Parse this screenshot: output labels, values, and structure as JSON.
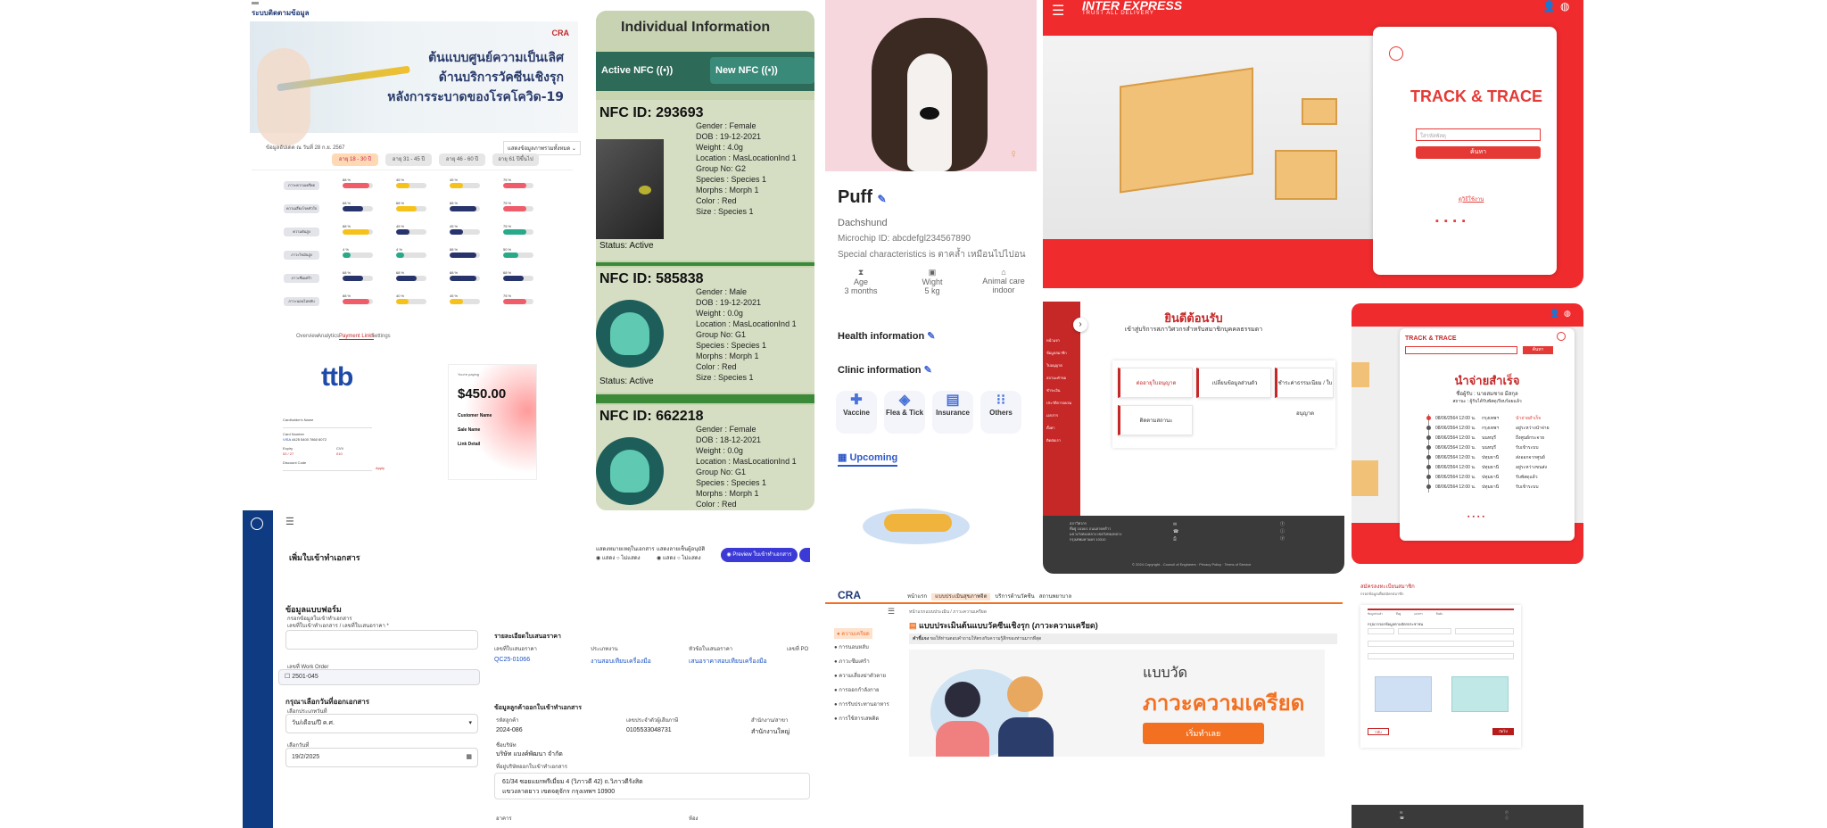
{
  "vaccine": {
    "app_title": "ระบบติดตามข้อมูล",
    "logo_text": "CRA",
    "hero_lines": [
      "ต้นแบบศูนย์ความเป็นเลิศ",
      "ด้านบริการวัคซีนเชิงรุก",
      "หลังการระบาดของโรคโควิด-19"
    ],
    "updated_note": "ข้อมูลอัปเดต ณ วันที่ 28 ก.ย. 2567",
    "dropdown": "แสดงข้อมูลภาพรวมทั้งหมด",
    "age_tabs": [
      "อายุ 18 - 30 ปี",
      "อายุ 31 - 45 ปี",
      "อายุ 46 - 60 ปี",
      "อายุ 61 ปีขึ้นไป"
    ],
    "row_labels": [
      "ภาวะความเครียด",
      "ความเสี่ยงโรคหัวใจ",
      "ความดันสูง",
      "ภาวะไขมันสูง",
      "ภาวะซึมเศร้า",
      "ภาวะนอนไม่หลับ"
    ],
    "bar_rows": [
      [
        {
          "pct": "88 %",
          "value": 0.88,
          "color": "#ef5d6a"
        },
        {
          "pct": "45 %",
          "value": 0.45,
          "color": "#f6c21a"
        },
        {
          "pct": "45 %",
          "value": 0.45,
          "color": "#f6c21a"
        },
        {
          "pct": "75 %",
          "value": 0.75,
          "color": "#ef5d6a"
        }
      ],
      [
        {
          "pct": "68 %",
          "value": 0.68,
          "color": "#27336b"
        },
        {
          "pct": "68 %",
          "value": 0.68,
          "color": "#f6c21a"
        },
        {
          "pct": "88 %",
          "value": 0.88,
          "color": "#27336b"
        },
        {
          "pct": "75 %",
          "value": 0.75,
          "color": "#ef5d6a"
        }
      ],
      [
        {
          "pct": "88 %",
          "value": 0.88,
          "color": "#f6c21a"
        },
        {
          "pct": "45 %",
          "value": 0.45,
          "color": "#27336b"
        },
        {
          "pct": "45 %",
          "value": 0.45,
          "color": "#27336b"
        },
        {
          "pct": "75 %",
          "value": 0.75,
          "color": "#27a98a"
        }
      ],
      [
        {
          "pct": "4 %",
          "value": 0.25,
          "color": "#27a98a"
        },
        {
          "pct": "4 %",
          "value": 0.25,
          "color": "#27a98a"
        },
        {
          "pct": "88 %",
          "value": 0.88,
          "color": "#27336b"
        },
        {
          "pct": "50 %",
          "value": 0.5,
          "color": "#27a98a"
        }
      ],
      [
        {
          "pct": "68 %",
          "value": 0.68,
          "color": "#27336b"
        },
        {
          "pct": "68 %",
          "value": 0.68,
          "color": "#27336b"
        },
        {
          "pct": "88 %",
          "value": 0.88,
          "color": "#27336b"
        },
        {
          "pct": "68 %",
          "value": 0.68,
          "color": "#27336b"
        }
      ],
      [
        {
          "pct": "88 %",
          "value": 0.88,
          "color": "#ef5d6a"
        },
        {
          "pct": "40 %",
          "value": 0.4,
          "color": "#f6c21a"
        },
        {
          "pct": "45 %",
          "value": 0.45,
          "color": "#f6c21a"
        },
        {
          "pct": "75 %",
          "value": 0.75,
          "color": "#ef5d6a"
        }
      ]
    ]
  },
  "ttb": {
    "tabs": [
      "Overview",
      "Analytics",
      "Payment Links",
      "Settings"
    ],
    "logo": "ttb",
    "amount": "$450.00",
    "youre_paying": "You're paying",
    "customer_label": "Customer Name",
    "sale_label": "Sale Name",
    "link_label": "Link Detail",
    "apply": "Apply",
    "card_fields": [
      "Cardholder's Name",
      "Card Number",
      "Expiry",
      "CVV",
      "Discount Code"
    ],
    "card_number": "4425 5400 7860 6072",
    "expiry": "02 / 27",
    "cvv": "010"
  },
  "nfc": {
    "title": "Individual Information",
    "active_btn": "Active NFC",
    "new_btn": "New NFC",
    "cards": [
      {
        "id": "NFC ID: 293693",
        "status": "Status: Active",
        "fields": [
          "Gender : Female",
          "DOB : 19-12-2021",
          "Weight : 4.0g",
          "Location : MasLocationInd 1",
          "Group No: G2",
          "Species : Species 1",
          "Morphs : Morph 1",
          "Color : Red",
          "Size : Species 1"
        ]
      },
      {
        "id": "NFC ID: 585838",
        "status": "Status: Active",
        "fields": [
          "Gender : Male",
          "DOB : 19-12-2021",
          "Weight : 0.0g",
          "Location : MasLocationInd 1",
          "Group No: G1",
          "Species : Species 1",
          "Morphs : Morph 1",
          "Color : Red",
          "Size : Species 1"
        ]
      },
      {
        "id": "NFC ID: 662218",
        "status": "",
        "fields": [
          "Gender : Female",
          "DOB : 18-12-2021",
          "Weight : 0.0g",
          "Location : MasLocationInd 1",
          "Group No: G1",
          "Species : Species 1",
          "Morphs : Morph 1",
          "Color : Red"
        ]
      }
    ]
  },
  "pet": {
    "name": "Puff",
    "breed": "Dachshund",
    "microchip": "Microchip ID: abcdefgl234567890",
    "special": "Special characteristics is ตาคล้ำ เหมือนไปไปอน",
    "stats": [
      {
        "label": "Age",
        "value": "3 months"
      },
      {
        "label": "Wight",
        "value": "5 kg"
      },
      {
        "label": "Animal care",
        "value": "indoor"
      }
    ],
    "health": "Health information",
    "clinic": "Clinic information",
    "services": [
      "Vaccine",
      "Flea & Tick",
      "Insurance",
      "Others"
    ],
    "upcoming": "Upcoming"
  },
  "inter": {
    "brand": "INTER EXPRESS",
    "tagline": "TRUST ALL DELIVERY",
    "title": "TRACK & TRACE",
    "placeholder": "ใส่รหัสพัสดุ",
    "search_btn": "ค้นหา",
    "link": "ดูวิธีใช้งาน"
  },
  "welcome": {
    "title": "ยินดีต้อนรับ",
    "subtitle": "เข้าสู่บริการสภาวิศวกรสำหรับสมาชิกบุคคลธรรมดา",
    "cards": [
      "ต่ออายุใบอนุญาต",
      "เปลี่ยนข้อมูลส่วนตัว",
      "ชำระค่าธรรมเนียม / ใบอนุญาต",
      "ติดตามสถานะ"
    ],
    "side_items": [
      "หน้าแรก",
      "ข้อมูลสมาชิก",
      "ใบอนุญาต",
      "สถานะคำขอ",
      "ชำระเงิน",
      "ประวัติการอบรม",
      "เอกสาร",
      "ตั้งค่า",
      "ติดต่อเรา"
    ],
    "footer_lines": [
      "สภาวิศวกร",
      "ที่อยู่ 1616/1 ถนนลาดพร้าว",
      "แขวงวังทองหลาง เขตวังทองหลาง",
      "กรุงเทพมหานคร 10310"
    ],
    "copyright": "© 2024 Copyright - Council of Engineers",
    "links": [
      "Privacy Policy",
      "Terms of Service"
    ]
  },
  "success": {
    "title": "TRACK & TRACE",
    "search_btn": "ค้นหา",
    "headline": "นำจ่ายสำเร็จ",
    "receiver": "ชื่อผู้รับ : นายสมชาย มีสกุล",
    "note": "สถานะ : ผู้รับได้รับพัสดุเรียบร้อยแล้ว",
    "rows": [
      {
        "date": "08/06/2564 12:00 น.",
        "place": "กรุงเทพฯ",
        "status": "นำจ่ายสำเร็จ"
      },
      {
        "date": "08/06/2564 12:00 น.",
        "place": "กรุงเทพฯ",
        "status": "อยู่ระหว่างนำจ่าย"
      },
      {
        "date": "08/06/2564 12:00 น.",
        "place": "นนทบุรี",
        "status": "ถึงศูนย์กระจาย"
      },
      {
        "date": "08/06/2564 12:00 น.",
        "place": "นนทบุรี",
        "status": "รับเข้าระบบ"
      },
      {
        "date": "08/06/2564 12:00 น.",
        "place": "ปทุมธานี",
        "status": "ส่งออกจากศูนย์"
      },
      {
        "date": "08/06/2564 12:00 น.",
        "place": "ปทุมธานี",
        "status": "อยู่ระหว่างขนส่ง"
      },
      {
        "date": "08/06/2564 12:00 น.",
        "place": "ปทุมธานี",
        "status": "รับพัสดุแล้ว"
      },
      {
        "date": "08/06/2564 12:00 น.",
        "place": "ปทุมธานี",
        "status": "รับเข้าระบบ"
      }
    ]
  },
  "form": {
    "page_title": "เพิ่มใบเข้าทำเอกสาร",
    "option1_label": "แสดงหมายเหตุในเอกสาร",
    "option2_label": "แสดงลายเซ็นผู้อนุมัติ",
    "opt_show": "แสดง",
    "opt_hide": "ไม่แสดง",
    "preview_btn": "Preview ใบเข้าทำเอกสาร",
    "section1": "ข้อมูลแบบฟอร์ม",
    "doc_type_label": "กรอกข้อมูลใบเข้าทำเอกสาร",
    "doc_no_label": "เลขที่ใบเข้าทำเอกสาร / เลขที่ใบเสนอราคา *",
    "work_order_label": "เลขที่ Work Order",
    "work_order_option": "2501-045",
    "section2": "กรุณาเลือกวันที่ออกเอกสาร",
    "date_type_label": "เลือกประเภทวันที่",
    "date_type_value": "วัน/เดือน/ปี ค.ศ.",
    "date_label": "เลือกวันที่",
    "date_value": "19/2/2025",
    "quote_section": "รายละเอียดใบเสนอราคา",
    "quote_headers": [
      "เลขที่ใบเสนอราคา",
      "ประเภทงาน",
      "หัวข้อใบเสนอราคา",
      "เลขที่ PO"
    ],
    "quote_values": [
      "QC25-01066",
      "งานสอบเทียบเครื่องมือ",
      "เสนอราคาสอบเทียบเครื่องมือ"
    ],
    "customer_section": "ข้อมูลลูกค้าออกใบเข้าทำเอกสาร",
    "customer_headers": [
      "รหัสลูกค้า",
      "เลขประจำตัวผู้เสียภาษี",
      "สำนักงาน/สาขา"
    ],
    "customer_values": [
      "2024-086",
      "0105533048731",
      "สำนักงานใหญ่"
    ],
    "company_label": "ชื่อบริษัท",
    "company_value": "บริษัท แบงค์พัฒนา จำกัด",
    "address_label": "ที่อยู่บริษัทออกใบเข้าทำเอกสาร",
    "address_lines": [
      "61/34 ซอยแยกพรีเมี่ยม 4 (วิภาวดี 42) ถ.วิภาวดีรังสิต",
      "แขวงลาดยาว เขตจตุจักร กรุงเทพฯ 10900"
    ],
    "bottom_labels": [
      "อาคาร",
      "ห้อง"
    ]
  },
  "cra": {
    "logo": "CRA",
    "nav": [
      "หน้าแรก",
      "แบบประเมินสุขภาพจิต",
      "บริการด้านวัคซีน",
      "สถานพยาบาล"
    ],
    "breadcrumb": [
      "หน้าแรกแบบประเมิน",
      "ภาวะความเครียด"
    ],
    "side": [
      "ความเครียด",
      "การนอนหลับ",
      "ภาวะซึมเศร้า",
      "ความเสี่ยงฆ่าตัวตาย",
      "การออกกำลังกาย",
      "การรับประทานอาหาร",
      "การใช้สารเสพติด"
    ],
    "heading": "แบบประเมินต้นแบบวัคซีนเชิงรุก (ภาวะความเครียด)",
    "instruction_label": "คำชี้แจง",
    "instruction": "ขอให้ท่านตอบคำถามให้ตรงกับความรู้สึกของท่านมากที่สุด",
    "banner_small": "แบบวัด",
    "banner_big": "ภาวะความเครียด",
    "start_btn": "เริ่มทำเลย"
  },
  "reg": {
    "title": "สมัครลงทะเบียนสมาชิก",
    "subtitle": "กรอกข้อมูลเพื่อสมัครสมาชิก",
    "steps": [
      "ข้อมูลส่วนตัว",
      "ที่อยู่",
      "เอกสาร",
      "ยืนยัน"
    ],
    "section": "กรุณากรอกข้อมูลตามบัตรประชาชน",
    "back": "กลับ",
    "next": "ถัดไป"
  }
}
